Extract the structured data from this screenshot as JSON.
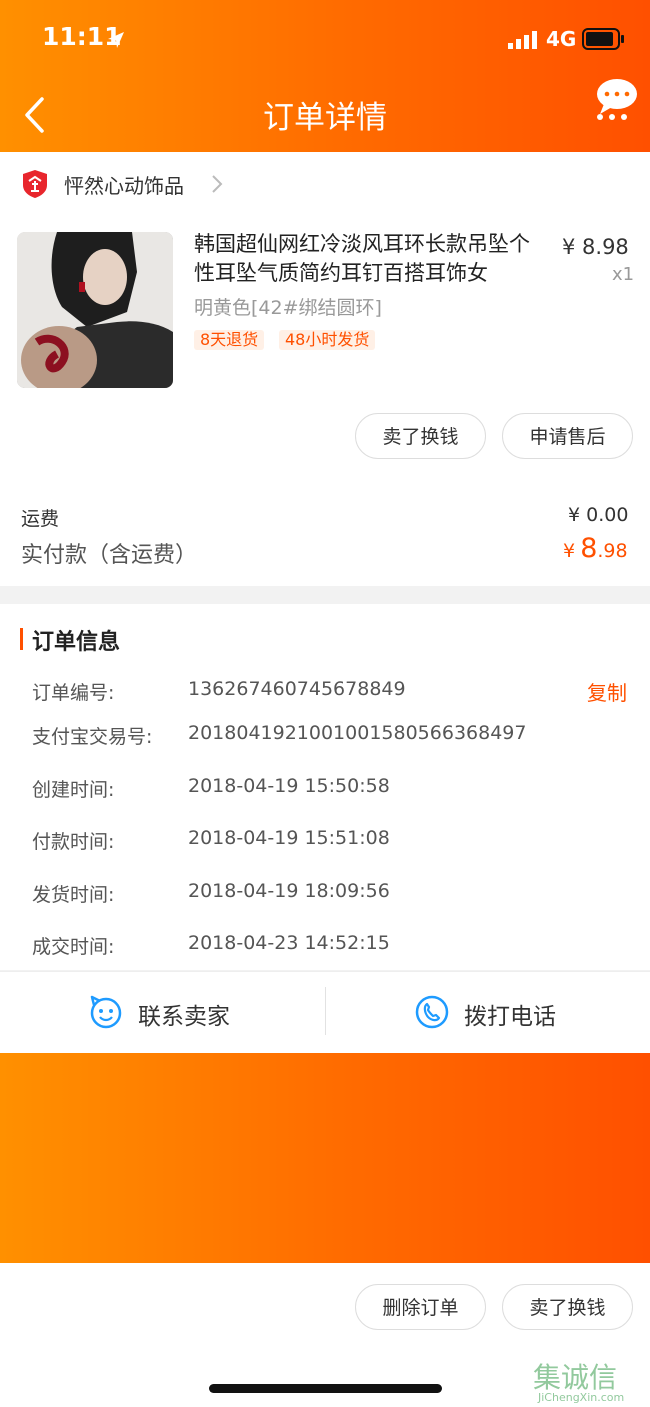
{
  "status_bar": {
    "time": "11:11",
    "network": "4G"
  },
  "header": {
    "title": "订单详情"
  },
  "shop": {
    "name": "怦然心动饰品"
  },
  "product": {
    "title": "韩国超仙网红冷淡风耳环长款吊坠个性耳坠气质简约耳钉百搭耳饰女",
    "spec": "明黄色[42#绑结圆环]",
    "tags": [
      "8天退货",
      "48小时发货"
    ],
    "price": "¥ 8.98",
    "quantity": "x1"
  },
  "item_actions": {
    "sell_label": "卖了换钱",
    "aftersale_label": "申请售后"
  },
  "summary": {
    "shipping_label": "运费",
    "shipping_value": "¥ 0.00",
    "paid_label": "实付款（含运费）",
    "paid_currency": "¥",
    "paid_int": "8",
    "paid_dec": ".98"
  },
  "order_info": {
    "heading": "订单信息",
    "copy_label": "复制",
    "rows": [
      {
        "label": "订单编号:",
        "value": "136267460745678849"
      },
      {
        "label": "支付宝交易号:",
        "value": "2018041921001001580566368497"
      },
      {
        "label": "创建时间:",
        "value": "2018-04-19 15:50:58"
      },
      {
        "label": "付款时间:",
        "value": "2018-04-19 15:51:08"
      },
      {
        "label": "发货时间:",
        "value": "2018-04-19 18:09:56"
      },
      {
        "label": "成交时间:",
        "value": "2018-04-23 14:52:15"
      }
    ]
  },
  "contact": {
    "seller_label": "联系卖家",
    "call_label": "拨打电话"
  },
  "footer": {
    "delete_label": "删除订单",
    "sell_label": "卖了换钱"
  },
  "watermark": {
    "brand": "集诚信",
    "url": "JiChengXin.com"
  },
  "colors": {
    "accent": "#ff5000",
    "accent_start": "#ff9000",
    "link_blue": "#1e9bff"
  }
}
